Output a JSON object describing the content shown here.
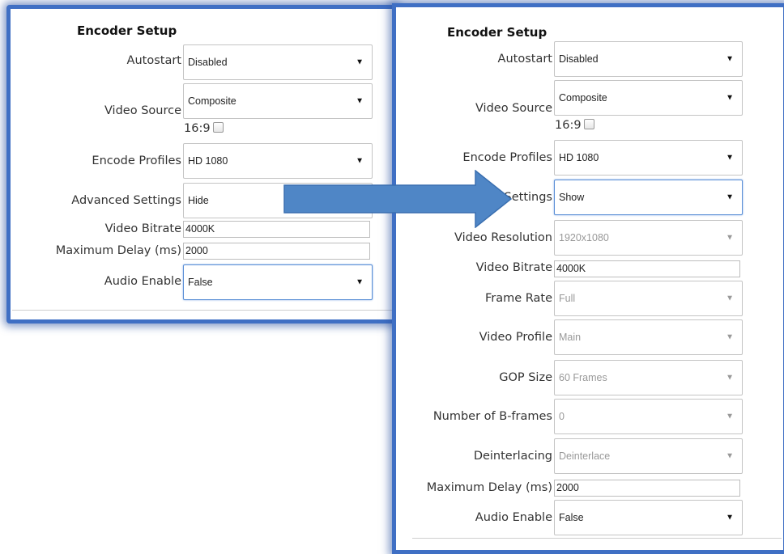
{
  "left": {
    "title": "Encoder Setup",
    "autostart": {
      "label": "Autostart",
      "value": "Disabled"
    },
    "video_source": {
      "label": "Video Source",
      "value": "Composite",
      "aspect_label": "16:9"
    },
    "encode_profiles": {
      "label": "Encode Profiles",
      "value": "HD 1080"
    },
    "advanced_settings": {
      "label": "Advanced Settings",
      "value": "Hide"
    },
    "video_bitrate": {
      "label": "Video Bitrate",
      "value": "4000K"
    },
    "max_delay": {
      "label": "Maximum Delay (ms)",
      "value": "2000"
    },
    "audio_enable": {
      "label": "Audio Enable",
      "value": "False"
    }
  },
  "right": {
    "title": "Encoder Setup",
    "autostart": {
      "label": "Autostart",
      "value": "Disabled"
    },
    "video_source": {
      "label": "Video Source",
      "value": "Composite",
      "aspect_label": "16:9"
    },
    "encode_profiles": {
      "label": "Encode Profiles",
      "value": "HD 1080"
    },
    "advanced_settings": {
      "label": "Settings",
      "value": "Show"
    },
    "video_resolution": {
      "label": "Video Resolution",
      "value": "1920x1080"
    },
    "video_bitrate": {
      "label": "Video Bitrate",
      "value": "4000K"
    },
    "frame_rate": {
      "label": "Frame Rate",
      "value": "Full"
    },
    "video_profile": {
      "label": "Video Profile",
      "value": "Main"
    },
    "gop_size": {
      "label": "GOP Size",
      "value": "60 Frames"
    },
    "b_frames": {
      "label": "Number of B-frames",
      "value": "0"
    },
    "deinterlacing": {
      "label": "Deinterlacing",
      "value": "Deinterlace"
    },
    "max_delay": {
      "label": "Maximum Delay (ms)",
      "value": "2000"
    },
    "audio_enable": {
      "label": "Audio Enable",
      "value": "False"
    }
  },
  "arrow_icon": "arrow-right-icon",
  "colors": {
    "panel_border": "#3f6fc4",
    "arrow_fill": "#4f86c6",
    "focus_border": "#5a8fd6"
  }
}
